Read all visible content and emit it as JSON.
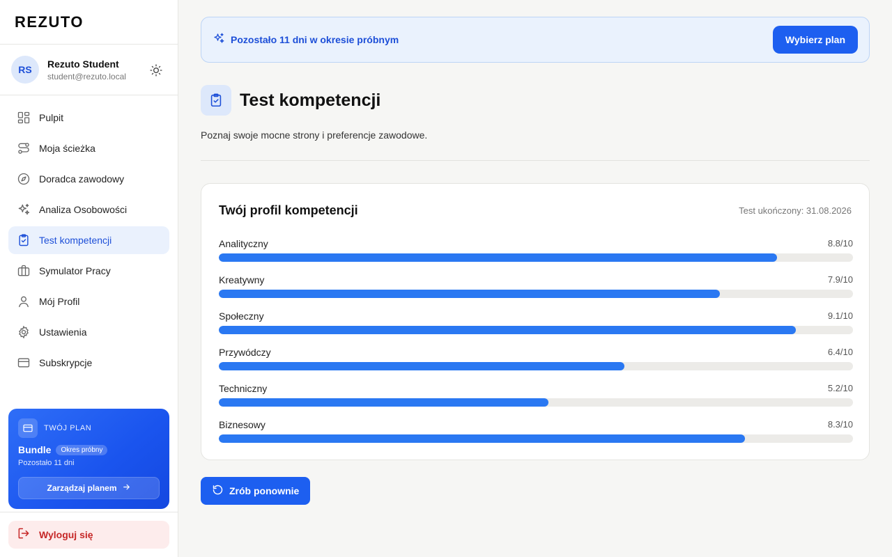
{
  "brand": {
    "logo_text": "REZUTO"
  },
  "user": {
    "initials": "RS",
    "name": "Rezuto Student",
    "email": "student@rezuto.local"
  },
  "sidebar": {
    "items": [
      {
        "label": "Pulpit",
        "icon": "dashboard-icon"
      },
      {
        "label": "Moja ścieżka",
        "icon": "path-icon"
      },
      {
        "label": "Doradca zawodowy",
        "icon": "compass-icon"
      },
      {
        "label": "Analiza Osobowości",
        "icon": "sparkles-icon"
      },
      {
        "label": "Test kompetencji",
        "icon": "clipboard-check-icon",
        "active": true
      },
      {
        "label": "Symulator Pracy",
        "icon": "briefcase-icon"
      },
      {
        "label": "Mój Profil",
        "icon": "user-icon"
      },
      {
        "label": "Ustawienia",
        "icon": "gear-icon"
      },
      {
        "label": "Subskrypcje",
        "icon": "credit-card-icon"
      }
    ],
    "plan": {
      "label": "TWÓJ PLAN",
      "name": "Bundle",
      "badge": "Okres próbny",
      "remaining": "Pozostało 11 dni",
      "manage_label": "Zarządzaj planem"
    },
    "logout_label": "Wyloguj się"
  },
  "trial_banner": {
    "text": "Pozostało 11 dni w okresie próbnym",
    "button_label": "Wybierz plan"
  },
  "page": {
    "title": "Test kompetencji",
    "description": "Poznaj swoje mocne strony i preferencje zawodowe."
  },
  "profile_card": {
    "title": "Twój profil kompetencji",
    "completed": "Test ukończony: 31.08.2026",
    "skills": [
      {
        "name": "Analityczny",
        "score_text": "8.8/10",
        "score": 8.8
      },
      {
        "name": "Kreatywny",
        "score_text": "7.9/10",
        "score": 7.9
      },
      {
        "name": "Społeczny",
        "score_text": "9.1/10",
        "score": 9.1
      },
      {
        "name": "Przywódczy",
        "score_text": "6.4/10",
        "score": 6.4
      },
      {
        "name": "Techniczny",
        "score_text": "5.2/10",
        "score": 5.2
      },
      {
        "name": "Biznesowy",
        "score_text": "8.3/10",
        "score": 8.3
      }
    ],
    "max_score": 10
  },
  "retry_label": "Zrób ponownie",
  "colors": {
    "accent": "#1d5ff0",
    "bar_fill": "#2a78f2",
    "bar_track": "#ecebe8",
    "active_bg": "#eaf1fd",
    "danger": "#c62828"
  }
}
